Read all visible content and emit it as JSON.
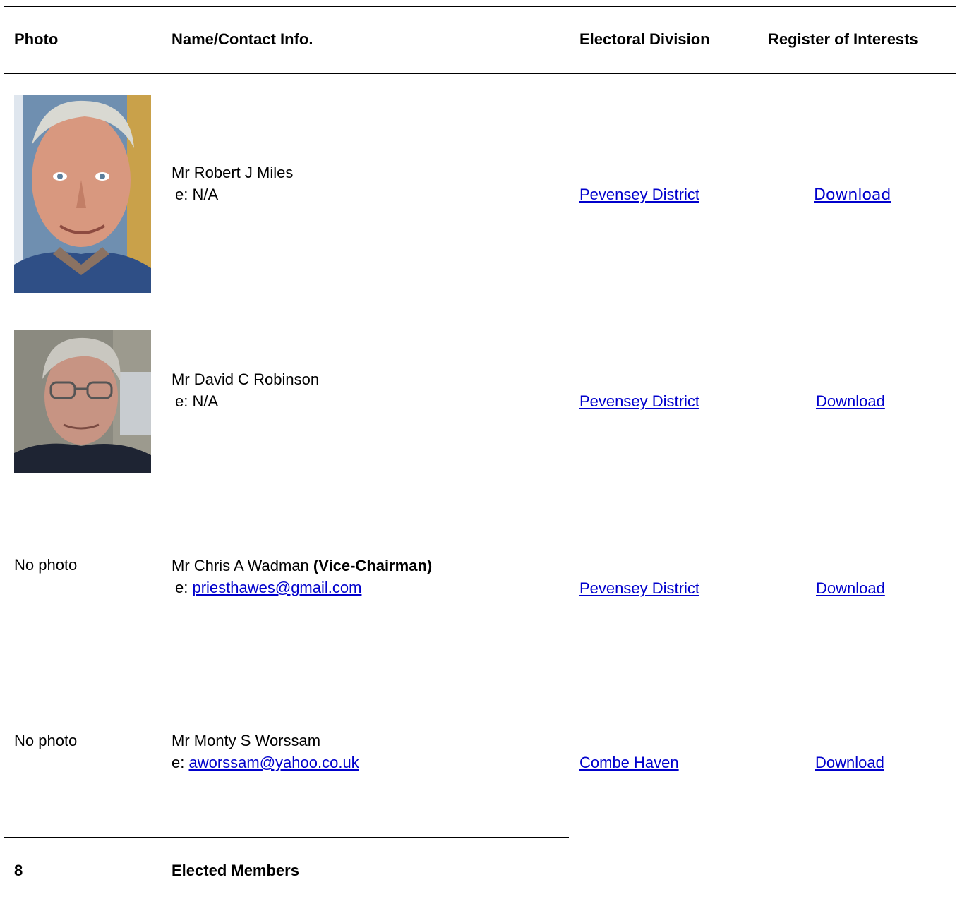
{
  "headers": {
    "photo": "Photo",
    "name": "Name/Contact Info.",
    "division": "Electoral Division",
    "interests": "Register of Interests"
  },
  "members": [
    {
      "name": "Mr Robert J Miles",
      "role": "",
      "email_prefix": "e: ",
      "email": "N/A",
      "division": "Pevensey District",
      "interests": "Download",
      "photo": "member-photo"
    },
    {
      "name": "Mr David C Robinson",
      "role": "",
      "email_prefix": "e: ",
      "email": "N/A",
      "division": "Pevensey District",
      "interests": "Download",
      "photo": "member-photo"
    },
    {
      "name": "Mr Chris A Wadman",
      "role": "(Vice-Chairman)",
      "email_prefix": "e: ",
      "email": "priesthawes@gmail.com",
      "division": "Pevensey District",
      "interests": "Download",
      "no_photo": "No photo"
    },
    {
      "name": "Mr Monty S Worssam",
      "role": "",
      "email_prefix": "e: ",
      "email": "aworssam@yahoo.co.uk",
      "division": "Combe Haven",
      "interests": "Download",
      "no_photo": "No photo"
    }
  ],
  "footer": {
    "count": "8",
    "label": "Elected Members"
  },
  "colors": {
    "link": "#0000cc",
    "text": "#000000",
    "rule": "#000000"
  }
}
